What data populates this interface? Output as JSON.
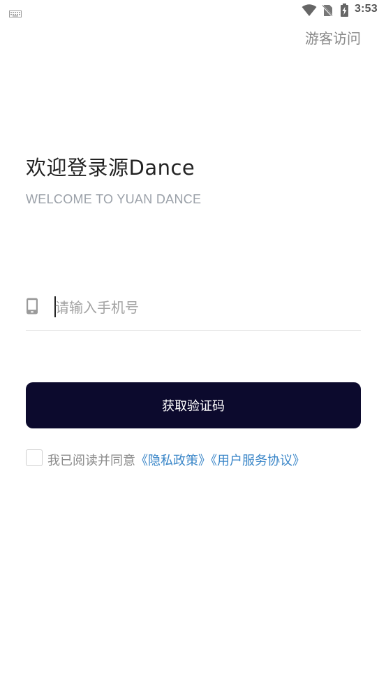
{
  "status_bar": {
    "time": "3:53",
    "icons": [
      "keyboard-icon",
      "wifi-icon",
      "no-sim-icon",
      "battery-charging-icon"
    ]
  },
  "header": {
    "guest_label": "游客访问"
  },
  "welcome": {
    "title": "欢迎登录源Dance",
    "subtitle": "WELCOME TO YUAN DANCE"
  },
  "phone": {
    "icon": "mobile-phone-icon",
    "placeholder": "请输入手机号",
    "value": ""
  },
  "actions": {
    "get_code_label": "获取验证码"
  },
  "agreement": {
    "checked": false,
    "prefix": "我已阅读并同意",
    "privacy_link": "《隐私政策》",
    "service_link": "《用户服务协议》"
  },
  "colors": {
    "button_bg": "#0c0a2d",
    "link": "#3a86c8",
    "subtitle": "#9aa0a8",
    "muted_text": "#8a8a8a"
  }
}
